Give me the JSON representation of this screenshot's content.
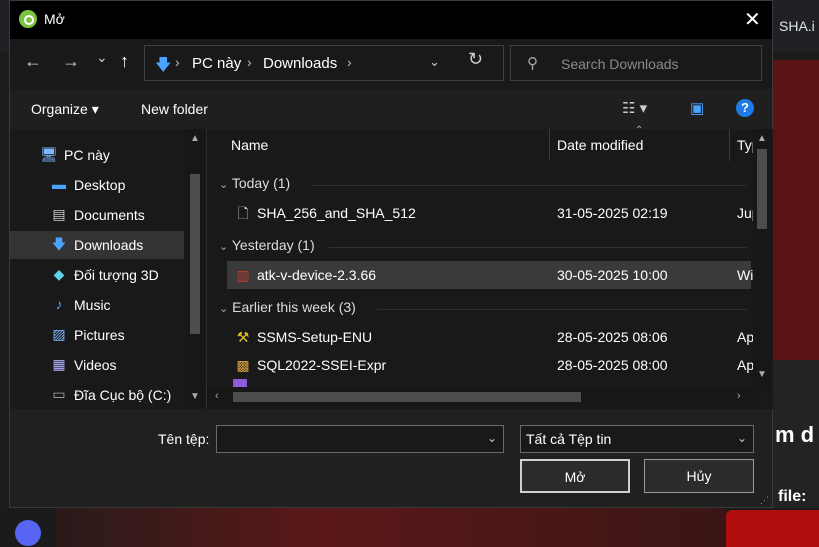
{
  "background": {
    "site_text": "SHA.i",
    "heading_fragment": "m d",
    "file_fragment": "file:"
  },
  "dialog": {
    "title": "Mở",
    "close_symbol": "✕"
  },
  "nav": {
    "back": "←",
    "forward": "→",
    "recent": "⌄",
    "up": "↑",
    "breadcrumb": [
      "PC này",
      "Downloads"
    ],
    "refresh": "↻"
  },
  "search": {
    "placeholder": "Search Downloads"
  },
  "toolbar": {
    "organize": "Organize ▾",
    "new_folder": "New folder",
    "help": "?"
  },
  "sidebar": {
    "items": [
      {
        "label": "PC này",
        "icon": "computer-icon"
      },
      {
        "label": "Desktop",
        "icon": "desktop-icon"
      },
      {
        "label": "Documents",
        "icon": "documents-icon"
      },
      {
        "label": "Downloads",
        "icon": "downloads-icon"
      },
      {
        "label": "Đối tượng 3D",
        "icon": "objects-3d-icon"
      },
      {
        "label": "Music",
        "icon": "music-icon"
      },
      {
        "label": "Pictures",
        "icon": "pictures-icon"
      },
      {
        "label": "Videos",
        "icon": "videos-icon"
      },
      {
        "label": "Đĩa Cục bộ (C:)",
        "icon": "drive-icon"
      }
    ],
    "selected": "Downloads"
  },
  "columns": {
    "name": "Name",
    "date": "Date modified",
    "type": "Typ"
  },
  "groups": [
    {
      "label": "Today (1)",
      "files": [
        {
          "name": "SHA_256_and_SHA_512",
          "date": "31-05-2025 02:19",
          "type": "Jup"
        }
      ]
    },
    {
      "label": "Yesterday (1)",
      "files": [
        {
          "name": "atk-v-device-2.3.66",
          "date": "30-05-2025 10:00",
          "type": "Wi"
        }
      ]
    },
    {
      "label": "Earlier this week (3)",
      "files": [
        {
          "name": "SSMS-Setup-ENU",
          "date": "28-05-2025 08:06",
          "type": "Ap"
        },
        {
          "name": "SQL2022-SSEI-Expr",
          "date": "28-05-2025 08:00",
          "type": "Ap"
        }
      ]
    }
  ],
  "footer": {
    "filename_label": "Tên tệp:",
    "filename_value": "",
    "filetype": "Tất cả Tệp tin",
    "open_button": "Mở",
    "cancel_button": "Hủy"
  }
}
